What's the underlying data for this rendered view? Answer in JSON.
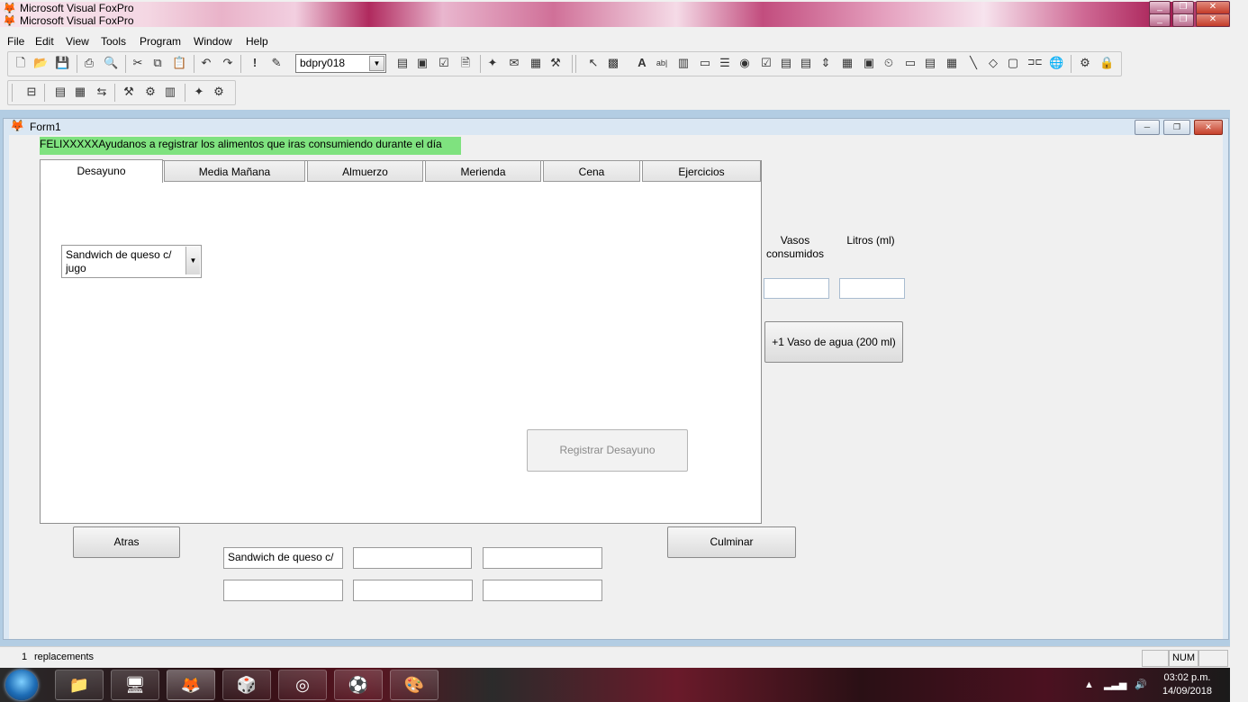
{
  "app": {
    "title": "Microsoft Visual FoxPro",
    "title2": "Microsoft Visual FoxPro",
    "window_buttons": {
      "minimize": "_",
      "restore": "❐",
      "close": "✕"
    }
  },
  "menu": {
    "items": [
      "File",
      "Edit",
      "View",
      "Tools",
      "Program",
      "Window",
      "Help"
    ]
  },
  "toolbar": {
    "database_combo_value": "bdpry018"
  },
  "form": {
    "title": "Form1",
    "header_label": "FELIXXXXXAyudanos a registrar los alimentos que iras consumiendo durante el día",
    "tabs": [
      "Desayuno",
      "Media Mañana",
      "Almuerzo",
      "Merienda",
      "Cena",
      "Ejercicios"
    ],
    "active_tab": "Desayuno",
    "food_dropdown_value": "Sandwich de queso c/ jugo",
    "register_button": "Registrar Desayuno",
    "water": {
      "glasses_label": "Vasos consumidos",
      "liters_label": "Litros (ml)",
      "glasses_value": "",
      "liters_value": "",
      "add_button": "+1 Vaso de agua (200 ml)"
    },
    "back_button": "Atras",
    "finish_button": "Culminar",
    "summary_fields": [
      [
        "Sandwich de queso c/",
        "",
        ""
      ],
      [
        "",
        "",
        ""
      ]
    ]
  },
  "statusbar": {
    "record": "1",
    "text": "replacements",
    "num": "NUM"
  },
  "taskbar": {
    "time": "03:02 p.m.",
    "date": "14/09/2018"
  }
}
